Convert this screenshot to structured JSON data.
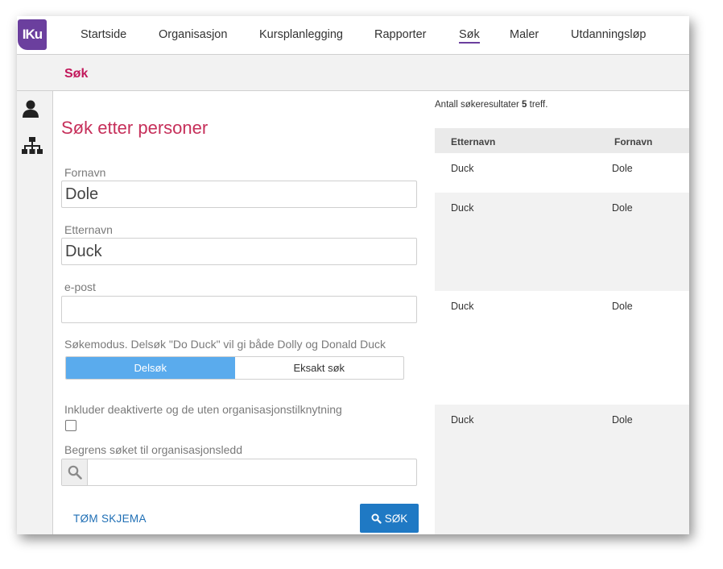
{
  "app": {
    "logo_text": "IKu",
    "accent": "#6b3f9e",
    "brand_red": "#c2185b"
  },
  "nav": {
    "items": [
      {
        "label": "Startside"
      },
      {
        "label": "Organisasjon"
      },
      {
        "label": "Kursplanlegging"
      },
      {
        "label": "Rapporter"
      },
      {
        "label": "Søk",
        "active": true
      },
      {
        "label": "Maler"
      },
      {
        "label": "Utdanningsløp"
      }
    ]
  },
  "page": {
    "title": "Søk"
  },
  "rail": {
    "icons": [
      "user-icon",
      "org-chart-icon"
    ]
  },
  "form": {
    "heading": "Søk etter personer",
    "first_name_label": "Fornavn",
    "first_name_value": "Dole",
    "last_name_label": "Etternavn",
    "last_name_value": "Duck",
    "email_label": "e-post",
    "email_value": "",
    "mode_label": "Søkemodus. Delsøk \"Do Duck\" vil gi både Dolly og Donald Duck",
    "mode_options": [
      {
        "label": "Delsøk",
        "selected": true
      },
      {
        "label": "Eksakt søk",
        "selected": false
      }
    ],
    "include_inactive_label": "Inkluder deaktiverte og de uten organisasjonstilknytning",
    "include_inactive_checked": false,
    "limit_org_label": "Begrens søket til organisasjonsledd",
    "limit_org_value": "",
    "clear_button": "TØM SKJEMA",
    "search_button": "SØK"
  },
  "results": {
    "count_prefix": "Antall søkeresultater",
    "count": "5",
    "count_suffix": "treff.",
    "columns": [
      "Etternavn",
      "Fornavn"
    ],
    "rows": [
      {
        "last": "Duck",
        "first": "Dole"
      },
      {
        "last": "Duck",
        "first": "Dole"
      },
      {
        "last": "Duck",
        "first": "Dole"
      },
      {
        "last": "Duck",
        "first": "Dole"
      }
    ]
  }
}
